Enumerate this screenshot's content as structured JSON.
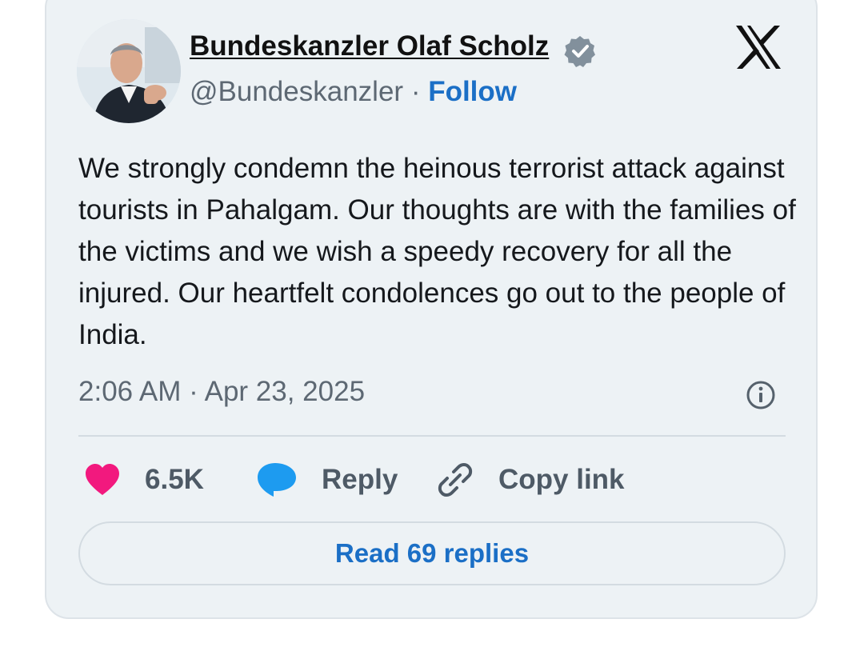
{
  "tweet": {
    "author_name": "Bundeskanzler Olaf Scholz",
    "handle": "@Bundeskanzler",
    "separator": "·",
    "follow_label": "Follow",
    "text": "We strongly condemn the heinous terrorist attack against tourists in Pahalgam. Our thoughts are with the families of the victims and we wish a speedy recovery for all the injured. Our heartfelt condolences go out to the people of India.",
    "time": "2:06 AM",
    "date": "Apr 23, 2025"
  },
  "actions": {
    "likes": "6.5K",
    "reply_label": "Reply",
    "copy_label": "Copy link",
    "read_replies_label": "Read 69 replies"
  },
  "icons": {
    "platform": "x-logo-icon",
    "verified": "verified-badge-icon",
    "info": "info-icon",
    "like": "heart-icon",
    "reply": "speech-bubble-icon",
    "copy": "link-icon"
  },
  "colors": {
    "card_bg": "#edf2f5",
    "link_blue": "#1b6fc6",
    "heart": "#f2197e",
    "reply_bubble": "#1d9bf0",
    "verified": "#82909c"
  }
}
